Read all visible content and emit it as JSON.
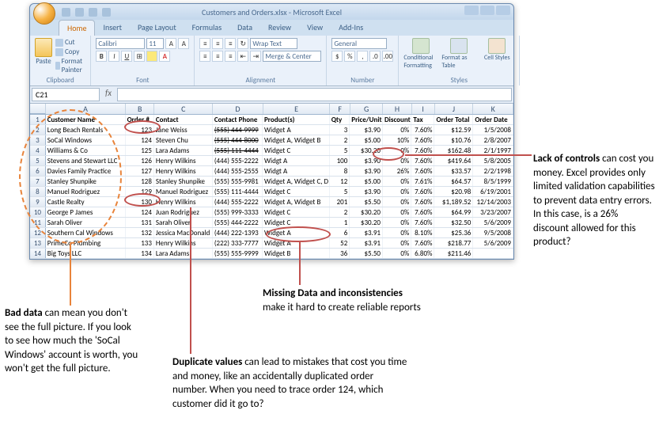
{
  "titlebar": {
    "title": "Customers and Orders.xlsx - Microsoft Excel"
  },
  "tabs": [
    "Home",
    "Insert",
    "Page Layout",
    "Formulas",
    "Data",
    "Review",
    "View",
    "Add-Ins"
  ],
  "clipboard": {
    "paste": "Paste",
    "cut": "Cut",
    "copy": "Copy",
    "painter": "Format Painter",
    "label": "Clipboard"
  },
  "font": {
    "name": "Calibri",
    "size": "11",
    "label": "Font"
  },
  "alignment": {
    "wrap": "Wrap Text",
    "merge": "Merge & Center",
    "label": "Alignment"
  },
  "number": {
    "format": "General",
    "label": "Number"
  },
  "styles": {
    "cond": "Conditional Formatting",
    "fmt": "Format as Table",
    "cell": "Cell Styles",
    "label": "Styles"
  },
  "namebox": "C21",
  "columns": [
    "A",
    "B",
    "C",
    "D",
    "E",
    "F",
    "G",
    "H",
    "I",
    "J",
    "K"
  ],
  "headers": [
    "Customer Name",
    "Order #",
    "Contact",
    "Contact Phone",
    "Product(s)",
    "Qty",
    "Price/Unit",
    "Discount",
    "Tax",
    "Order Total",
    "Order Date"
  ],
  "rows": [
    [
      "Long Beach Rentals",
      "123",
      "Jane Weiss",
      "(555) 444-9999",
      "Widget A",
      "3",
      "$3.90",
      "0%",
      "7.60%",
      "$12.59",
      "1/5/2008"
    ],
    [
      "SoCal Windows",
      "124",
      "Steven Chu",
      "(555) 444-8000",
      "Widget A, Widget B",
      "2",
      "$5.00",
      "10%",
      "7.60%",
      "$10.76",
      "2/8/2007"
    ],
    [
      "Williams & Co",
      "125",
      "Lara Adams",
      "(555) 111-4444",
      "Widget C",
      "5",
      "$30.20",
      "0%",
      "7.60%",
      "$162.48",
      "2/1/1997"
    ],
    [
      "Stevens and Stewart LLC",
      "126",
      "Henry Wilkins",
      "(444) 555-2222",
      "Widgt A",
      "100",
      "$3.90",
      "0%",
      "7.60%",
      "$419.64",
      "5/8/2005"
    ],
    [
      "Davies Family Practice",
      "127",
      "Henry Wilkins",
      "(444) 555-2555",
      "Widgt A",
      "8",
      "$3.90",
      "26%",
      "7.60%",
      "$33.57",
      "2/2/1998"
    ],
    [
      "Stanley Shunpike",
      "128",
      "Stanley Shunpike",
      "(555) 555-9981",
      "Widget A, Widget C, D",
      "12",
      "$5.00",
      "0%",
      "7.61%",
      "$64.57",
      "8/5/1999"
    ],
    [
      "Manuel Rodriguez",
      "129",
      "Manuel Rodriguez",
      "(555) 111-4444",
      "Widget C",
      "5",
      "$3.90",
      "0%",
      "7.60%",
      "$20.98",
      "6/19/2001"
    ],
    [
      "Castle Realty",
      "130",
      "Henry Wilkins",
      "(444) 555-2222",
      "Widget A, Widget B",
      "201",
      "$5.50",
      "0%",
      "7.60%",
      "$1,189.52",
      "12/14/2003"
    ],
    [
      "George P James",
      "124",
      "Juan Rodriguez",
      "(555) 999-3333",
      "Widget C",
      "2",
      "$30.20",
      "0%",
      "7.60%",
      "$64.99",
      "3/23/2007"
    ],
    [
      "Sarah Oliver",
      "131",
      "Sarah Oliver",
      "(555) 444-2222",
      "Widget C",
      "1",
      "$30.20",
      "0%",
      "7.60%",
      "$32.50",
      "5/6/2009"
    ],
    [
      "Southern Cal Windows",
      "132",
      "Jessica MacDonald",
      "(444) 222-1393",
      "Widget A",
      "6",
      "$3.91",
      "0%",
      "8.10%",
      "$25.36",
      "9/5/2008"
    ],
    [
      "PrimeCo Plumbing",
      "133",
      "Henry Wilkins",
      "(222) 333-7777",
      "Widget A",
      "52",
      "$3.91",
      "0%",
      "7.60%",
      "$218.77",
      "5/6/2009"
    ],
    [
      "Big Toys LLC",
      "134",
      "Lara Adams",
      "(555) 555-9999",
      "Widget B",
      "36",
      "$5.50",
      "0%",
      "6.80%",
      "$211.46",
      ""
    ]
  ],
  "annotations": {
    "bad_data": "<b>Bad data</b> can mean you don't see the full picture.  If you look to see how much the 'SoCal Windows' account is worth, you won't get the full picture.",
    "duplicate": "<b>Duplicate values</b> can lead to mistakes that cost you time and money, like an accidentally duplicated order number. When you need to trace order 124, which customer did it go to?",
    "missing": "<b>Missing Data and inconsistencies</b><br>make it hard to create reliable reports",
    "controls": "<b>Lack of controls</b> can cost you money.  Excel provides only limited validation capabilities to prevent data entry errors.   In this case, is a 26% discount allowed for this product?"
  }
}
